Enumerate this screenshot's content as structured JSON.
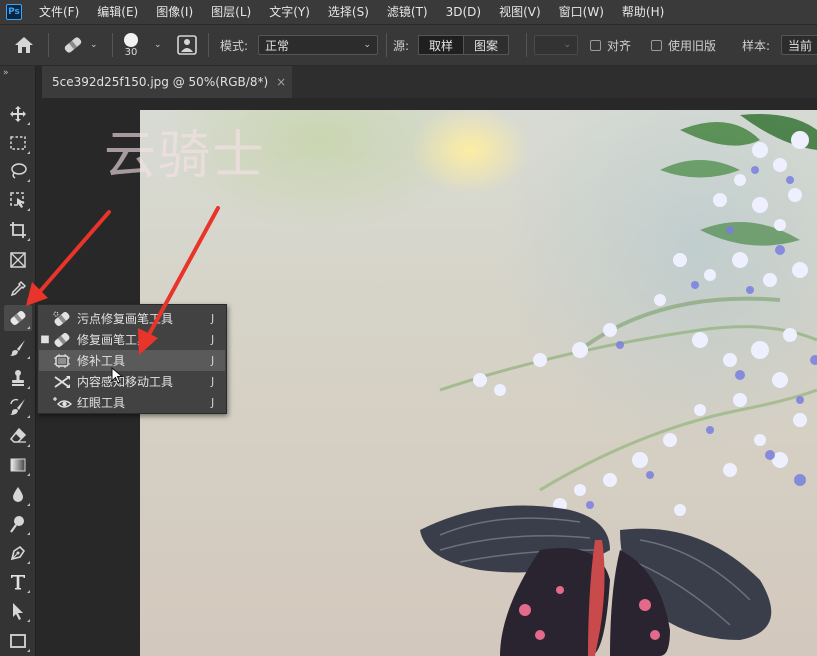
{
  "app": {
    "logo_text": "Ps"
  },
  "menu": {
    "items": [
      "文件(F)",
      "编辑(E)",
      "图像(I)",
      "图层(L)",
      "文字(Y)",
      "选择(S)",
      "滤镜(T)",
      "3D(D)",
      "视图(V)",
      "窗口(W)",
      "帮助(H)"
    ]
  },
  "options": {
    "brush_size": "30",
    "mode_label": "模式:",
    "mode_value": "正常",
    "source_label": "源:",
    "source_sample": "取样",
    "source_pattern": "图案",
    "aligned_label": "对齐",
    "legacy_label": "使用旧版",
    "sample_label": "样本:",
    "sample_value": "当前"
  },
  "document": {
    "tab_title": "5ce392d25f150.jpg @ 50%(RGB/8*)",
    "close_glyph": "×",
    "watermark": "云骑士"
  },
  "toolbar": {
    "collapse_glyph": "»"
  },
  "flyout": {
    "items": [
      {
        "label": "污点修复画笔工具",
        "key": "J",
        "icon": "spot-healing-brush-icon",
        "active": false
      },
      {
        "label": "修复画笔工具",
        "key": "J",
        "icon": "healing-brush-icon",
        "active": true
      },
      {
        "label": "修补工具",
        "key": "J",
        "icon": "patch-icon",
        "active": false,
        "hover": true
      },
      {
        "label": "内容感知移动工具",
        "key": "J",
        "icon": "content-aware-move-icon",
        "active": false
      },
      {
        "label": "红眼工具",
        "key": "J",
        "icon": "red-eye-icon",
        "active": false
      }
    ],
    "active_marker": "■"
  },
  "colors": {
    "accent_blue": "#31a8ff",
    "annotation_red": "#e8342a"
  }
}
